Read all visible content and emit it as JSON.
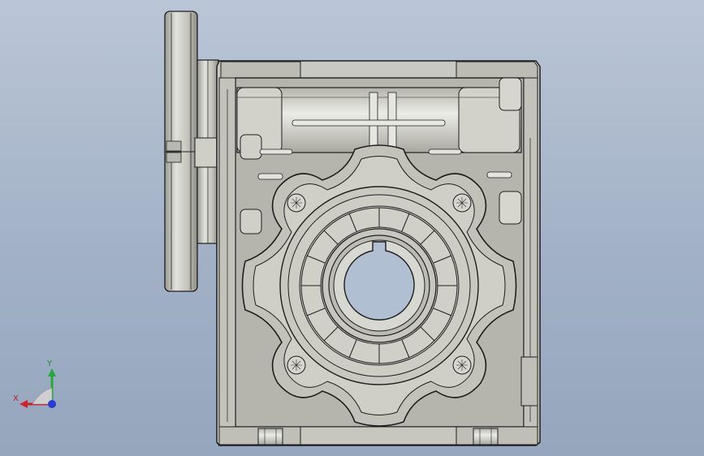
{
  "triad": {
    "x_label": "X",
    "y_label": "Y",
    "colors": {
      "x": "#d21f2a",
      "y": "#27a83a",
      "z": "#2a3bd6"
    }
  },
  "model": {
    "colors": {
      "metal_light": "#d8d8d2",
      "metal_mid": "#bdbdb6",
      "metal_dark": "#8c8c86",
      "edge": "#1e1e1e"
    }
  }
}
